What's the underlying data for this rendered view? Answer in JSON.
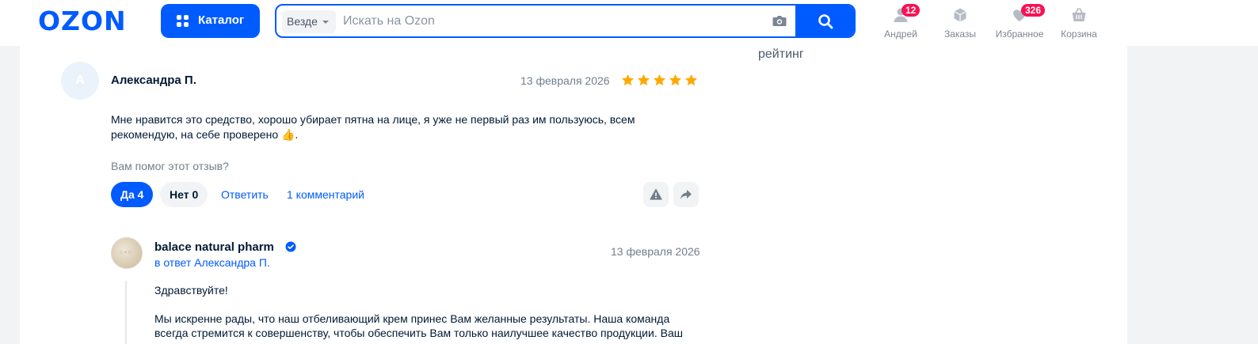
{
  "header": {
    "logo": "OZON",
    "catalog_label": "Каталог",
    "search": {
      "scope": "Везде",
      "placeholder": "Искать на Ozon"
    },
    "nav": [
      {
        "label": "Андрей",
        "icon": "user-icon",
        "badge": "12"
      },
      {
        "label": "Заказы",
        "icon": "box-icon",
        "badge": ""
      },
      {
        "label": "Избранное",
        "icon": "heart-icon",
        "badge": "326"
      },
      {
        "label": "Корзина",
        "icon": "basket-icon",
        "badge": ""
      }
    ]
  },
  "side": {
    "rating_label": "рейтинг"
  },
  "review": {
    "avatar_letter": "А",
    "author": "Александра П.",
    "date": "13 февраля 2026",
    "stars": 5,
    "text_line1": "Мне нравится это средство, хорошо убирает пятна на лице, я уже не первый раз им пользуюсь, всем",
    "text_line2": "рекомендую, на себе проверено 👍.",
    "helpful_question": "Вам помог этот отзыв?",
    "yes_label": "Да 4",
    "no_label": "Нет 0",
    "reply_label": "Ответить",
    "comments_label": "1 комментарий"
  },
  "reply": {
    "seller_name": "balace natural pharm",
    "in_reply_to": "в ответ Александра П.",
    "date": "13 февраля 2026",
    "greeting": "Здравствуйте!",
    "body_line1": "Мы искренне рады, что наш отбеливающий крем принес Вам желанные результаты. Наша команда",
    "body_line2": "всегда стремится к совершенству, чтобы обеспечить Вам только наилучшее качество продукции. Ваш"
  },
  "colors": {
    "brand": "#005bff",
    "badge": "#f91155",
    "star": "#ffa800"
  }
}
